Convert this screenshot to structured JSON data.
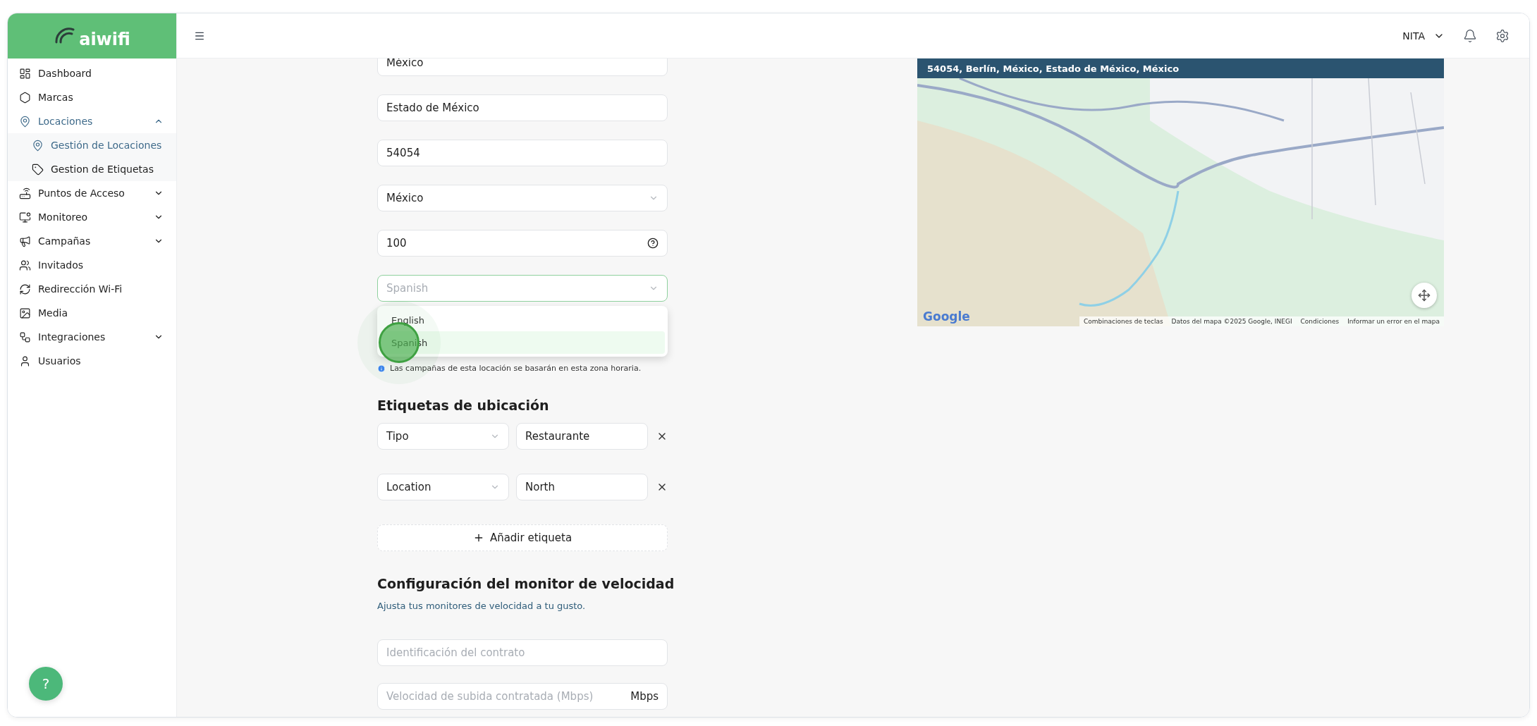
{
  "logo": {
    "text": "aiwifi"
  },
  "sidebar": {
    "items": [
      {
        "label": "Dashboard",
        "kind": "link",
        "selected": false
      },
      {
        "label": "Marcas",
        "kind": "link",
        "selected": false
      },
      {
        "label": "Locaciones",
        "kind": "group",
        "selected": true,
        "expanded": true,
        "children": [
          {
            "label": "Gestión de Locaciones",
            "selected": true
          },
          {
            "label": "Gestion de Etiquetas",
            "selected": false
          }
        ]
      },
      {
        "label": "Puntos de Acceso",
        "kind": "group",
        "selected": false,
        "expanded": false
      },
      {
        "label": "Monitoreo",
        "kind": "group",
        "selected": false,
        "expanded": false
      },
      {
        "label": "Campañas",
        "kind": "group",
        "selected": false,
        "expanded": false
      },
      {
        "label": "Invitados",
        "kind": "link",
        "selected": false
      },
      {
        "label": "Redirección Wi-Fi",
        "kind": "link",
        "selected": false
      },
      {
        "label": "Media",
        "kind": "link",
        "selected": false
      },
      {
        "label": "Integraciones",
        "kind": "group",
        "selected": false,
        "expanded": false
      },
      {
        "label": "Usuarios",
        "kind": "link",
        "selected": false
      }
    ]
  },
  "header": {
    "user": "NITA"
  },
  "form": {
    "fields": [
      {
        "kind": "text",
        "value": "México"
      },
      {
        "kind": "text",
        "value": "Estado de México"
      },
      {
        "kind": "text",
        "value": "54054"
      },
      {
        "kind": "select",
        "value": "México",
        "focused": false
      },
      {
        "kind": "help",
        "value": "100"
      },
      {
        "kind": "select",
        "placeholder": "Spanish",
        "focused": true
      }
    ],
    "dropdown": {
      "options": [
        {
          "label": "English",
          "selected": false
        },
        {
          "label": "Spanish",
          "selected": true
        }
      ]
    },
    "note": "Las campañas de esta locación se basarán en esta zona horaria."
  },
  "tags_section": {
    "title": "Etiquetas de ubicación",
    "rows": [
      {
        "key": "Tipo",
        "value": "Restaurante"
      },
      {
        "key": "Location",
        "value": "North"
      }
    ],
    "add_button": "Añadir etiqueta"
  },
  "speed_section": {
    "title": "Configuración del monitor de velocidad",
    "subtitle": "Ajusta tus monitores de velocidad a tu gusto.",
    "fields": [
      {
        "placeholder": "Identificación del contrato"
      },
      {
        "placeholder": "Velocidad de subida contratada (Mbps)",
        "unit": "Mbps"
      }
    ]
  },
  "map": {
    "title": "54054, Berlín, México, Estado de México, México",
    "logo": "Google",
    "attribution": [
      "Combinaciones de teclas",
      "Datos del mapa ©2025 Google, INEGI",
      "Condiciones",
      "Informar un error en el mapa"
    ]
  },
  "help_button": {
    "label": "?"
  }
}
